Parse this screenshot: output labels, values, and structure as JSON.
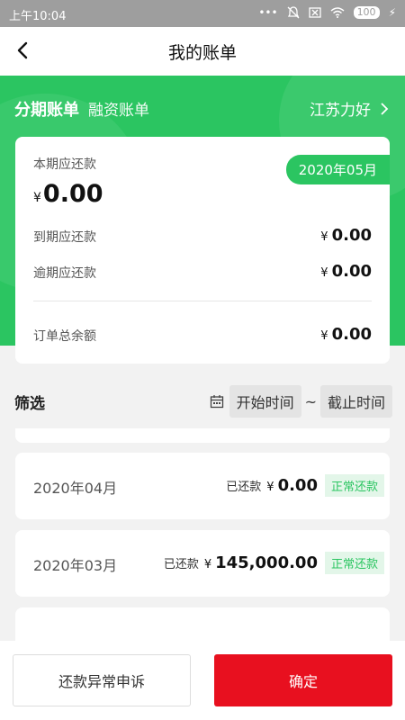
{
  "statusbar": {
    "time": "上午10:04",
    "icons": [
      "more-dots-icon",
      "mute-bell-icon",
      "close-box-icon",
      "wifi-icon"
    ],
    "battery": "100"
  },
  "nav": {
    "title": "我的账单"
  },
  "tabs": {
    "active": "分期账单",
    "other": "融资账单"
  },
  "company": {
    "name": "江苏力好"
  },
  "summary": {
    "date_badge": "2020年05月",
    "current_label": "本期应还款",
    "currency": "¥",
    "current_amount": "0.00",
    "due_label": "到期应还款",
    "due_amount": "0.00",
    "overdue_label": "逾期应还款",
    "overdue_amount": "0.00",
    "total_label": "订单总余额",
    "total_amount": "0.00"
  },
  "filter": {
    "title": "筛选",
    "start": "开始时间",
    "separator": "~",
    "end": "截止时间"
  },
  "bills": [
    {
      "month": "2020年04月",
      "paid_label": "已还款",
      "amount": "0.00",
      "status": "正常还款"
    },
    {
      "month": "2020年03月",
      "paid_label": "已还款",
      "amount": "145,000.00",
      "status": "正常还款"
    }
  ],
  "bottom": {
    "appeal": "还款异常申诉",
    "confirm": "确定"
  },
  "colors": {
    "brand_green": "#2bc561",
    "confirm_red": "#e8101f"
  }
}
